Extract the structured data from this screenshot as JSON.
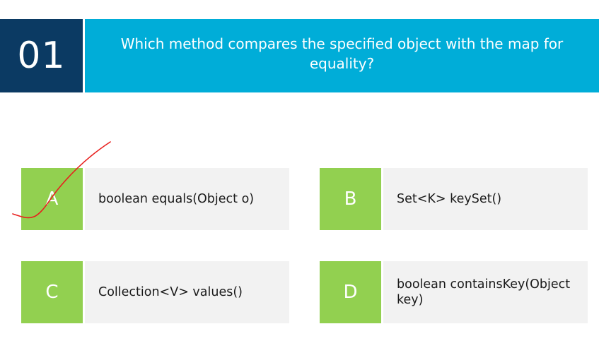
{
  "question": {
    "number": "01",
    "text": "Which method compares the specified object with the map for equality?"
  },
  "options": [
    {
      "letter": "A",
      "text": "boolean equals(Object o)"
    },
    {
      "letter": "B",
      "text": "Set<K> keySet()"
    },
    {
      "letter": "C",
      "text": "Collection<V> values()"
    },
    {
      "letter": "D",
      "text": "boolean containsKey(Object key)"
    }
  ],
  "annotation": {
    "type": "checkmark",
    "marked_option": "A",
    "color": "#e8201e"
  },
  "colors": {
    "number_bg": "#0b3a63",
    "question_bg": "#00add8",
    "letter_bg": "#92d050",
    "option_bg": "#f2f2f2"
  }
}
